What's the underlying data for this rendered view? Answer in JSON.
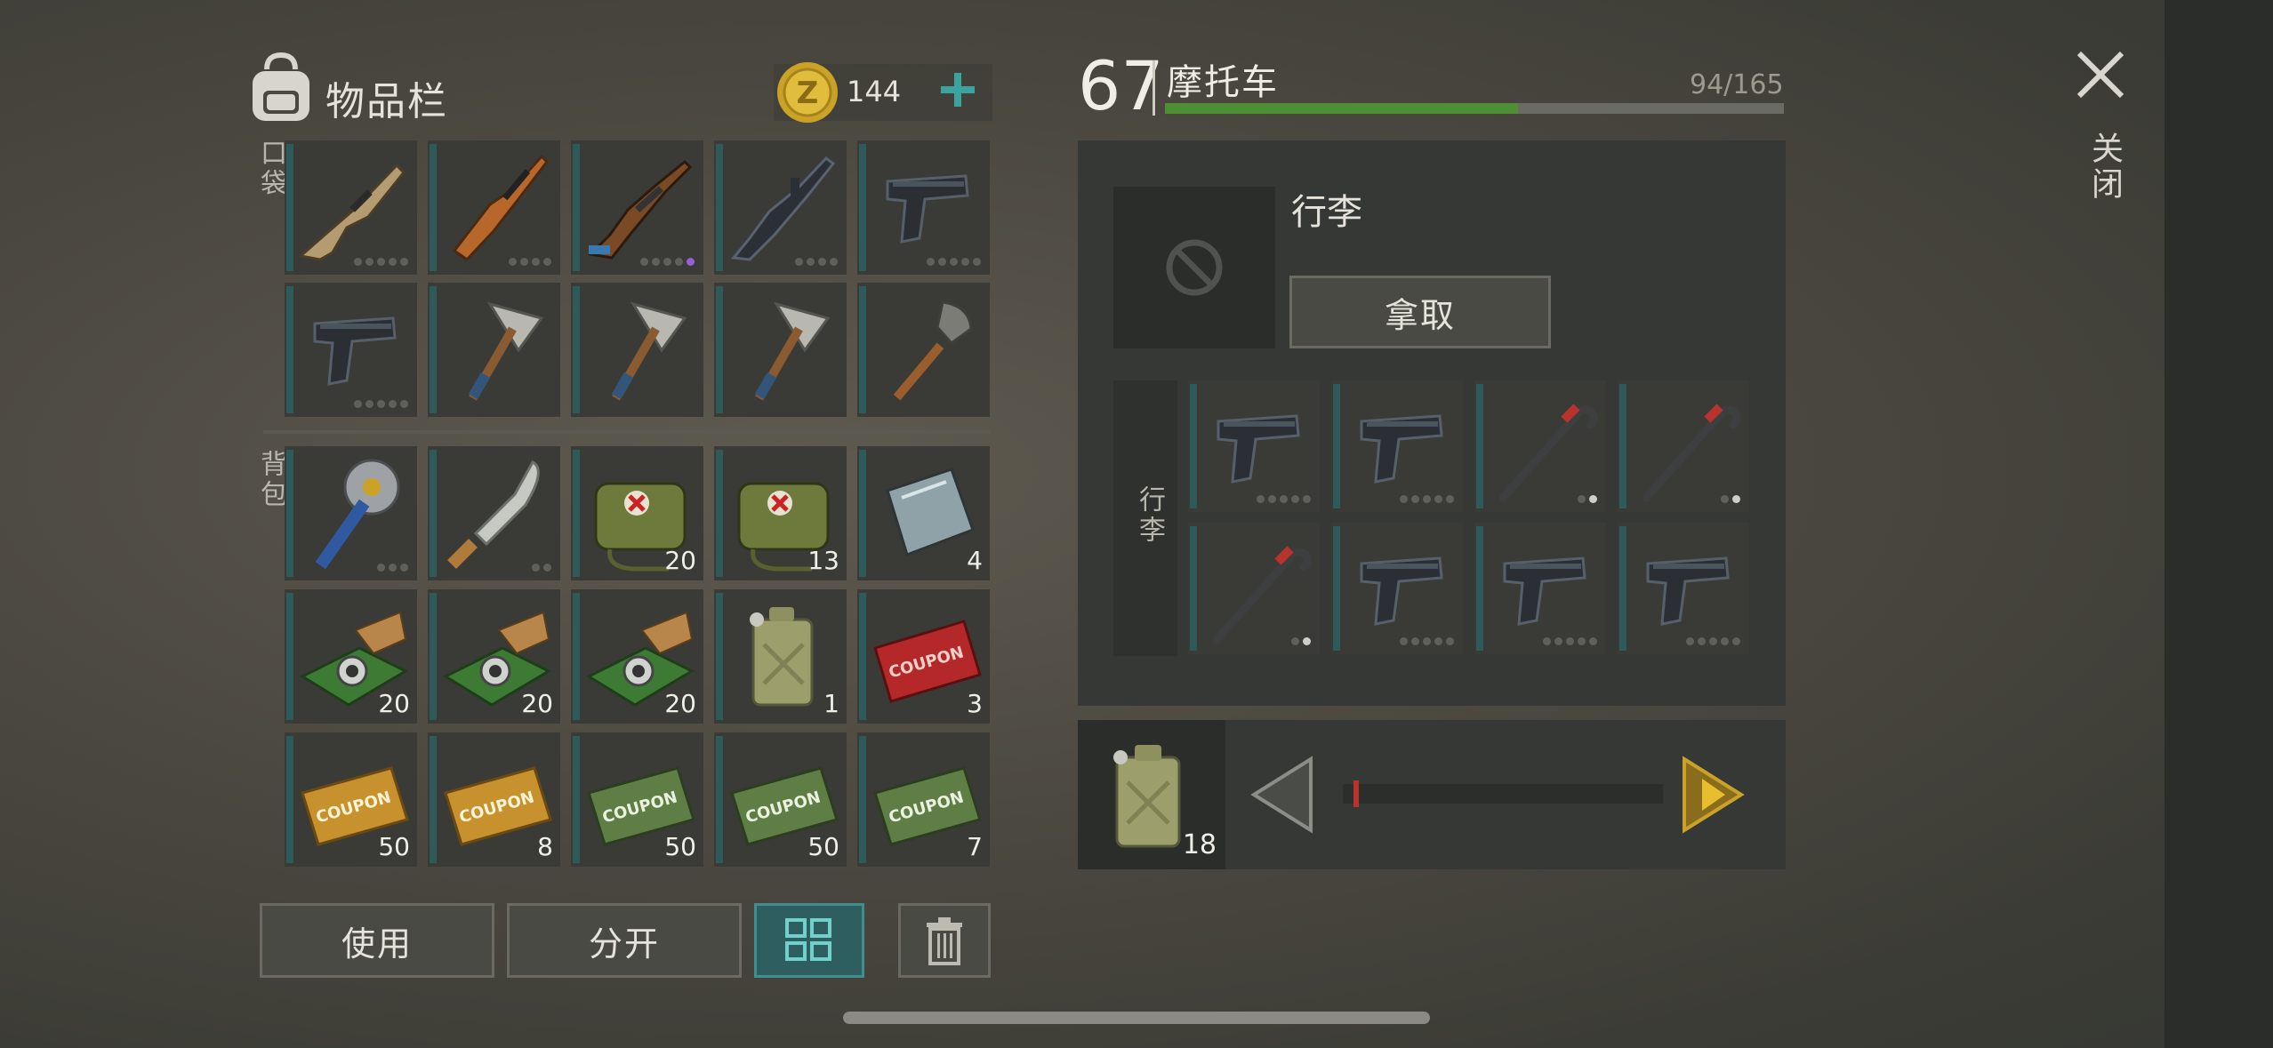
{
  "inventory": {
    "title": "物品栏",
    "coins": "144",
    "pocket_label": "口袋",
    "backpack_label": "背包",
    "pocket_items": [
      {
        "icon": "scar-rifle-icon",
        "count": "",
        "dots": 5
      },
      {
        "icon": "svd-rifle-icon",
        "count": "",
        "dots": 4
      },
      {
        "icon": "ak-rifle-icon",
        "count": "",
        "dots": 5,
        "purple_dot": true
      },
      {
        "icon": "m16-rifle-icon",
        "count": "",
        "dots": 4
      },
      {
        "icon": "pistol-icon",
        "count": "",
        "dots": 5
      },
      {
        "icon": "pistol-icon",
        "count": "",
        "dots": 5
      },
      {
        "icon": "pickaxe-icon",
        "count": "",
        "dots": 0
      },
      {
        "icon": "pickaxe-icon",
        "count": "",
        "dots": 0
      },
      {
        "icon": "pickaxe-icon",
        "count": "",
        "dots": 0
      },
      {
        "icon": "shovel-icon",
        "count": "",
        "dots": 0
      }
    ],
    "backpack_items": [
      {
        "icon": "saw-mace-icon",
        "count": "",
        "dots": 3
      },
      {
        "icon": "machete-icon",
        "count": "",
        "dots": 2
      },
      {
        "icon": "medkit-bag-icon",
        "count": "20",
        "dots": 0
      },
      {
        "icon": "medkit-bag-icon",
        "count": "13",
        "dots": 0
      },
      {
        "icon": "glass-sheet-icon",
        "count": "4",
        "dots": 0
      },
      {
        "icon": "circuit-board-icon",
        "count": "20",
        "dots": 0
      },
      {
        "icon": "circuit-board-icon",
        "count": "20",
        "dots": 0
      },
      {
        "icon": "circuit-board-icon",
        "count": "20",
        "dots": 0
      },
      {
        "icon": "jerrycan-icon",
        "count": "1",
        "dots": 0
      },
      {
        "icon": "combat-gear-coupon-icon",
        "count": "3",
        "dots": 0
      },
      {
        "icon": "survival-kit-coupon-icon",
        "count": "50",
        "dots": 0
      },
      {
        "icon": "survival-kit-coupon-icon",
        "count": "8",
        "dots": 0
      },
      {
        "icon": "ration-coupon-icon",
        "count": "50",
        "dots": 0
      },
      {
        "icon": "ration-coupon-icon",
        "count": "50",
        "dots": 0
      },
      {
        "icon": "ration-coupon-icon",
        "count": "7",
        "dots": 0
      }
    ],
    "buttons": {
      "use": "使用",
      "split": "分开"
    }
  },
  "vehicle": {
    "level": "67",
    "name": "摩托车",
    "capacity": "94/165",
    "capacity_fraction": 0.57,
    "luggage_title": "行李",
    "take_label": "拿取",
    "luggage_side_label": "行李",
    "luggage_items": [
      {
        "icon": "pistol-icon",
        "count": "",
        "dots": 5
      },
      {
        "icon": "pistol-icon",
        "count": "",
        "dots": 5
      },
      {
        "icon": "crowbar-icon",
        "count": "",
        "dots": 2
      },
      {
        "icon": "crowbar-icon",
        "count": "",
        "dots": 2
      },
      {
        "icon": "crowbar-icon",
        "count": "",
        "dots": 2
      },
      {
        "icon": "pistol-icon",
        "count": "",
        "dots": 5
      },
      {
        "icon": "pistol-icon",
        "count": "",
        "dots": 5
      },
      {
        "icon": "pistol-icon",
        "count": "",
        "dots": 5
      }
    ],
    "transfer_item": {
      "icon": "jerrycan-icon",
      "count": "18",
      "slider_fraction": 0.0
    }
  },
  "close_label": "关闭"
}
